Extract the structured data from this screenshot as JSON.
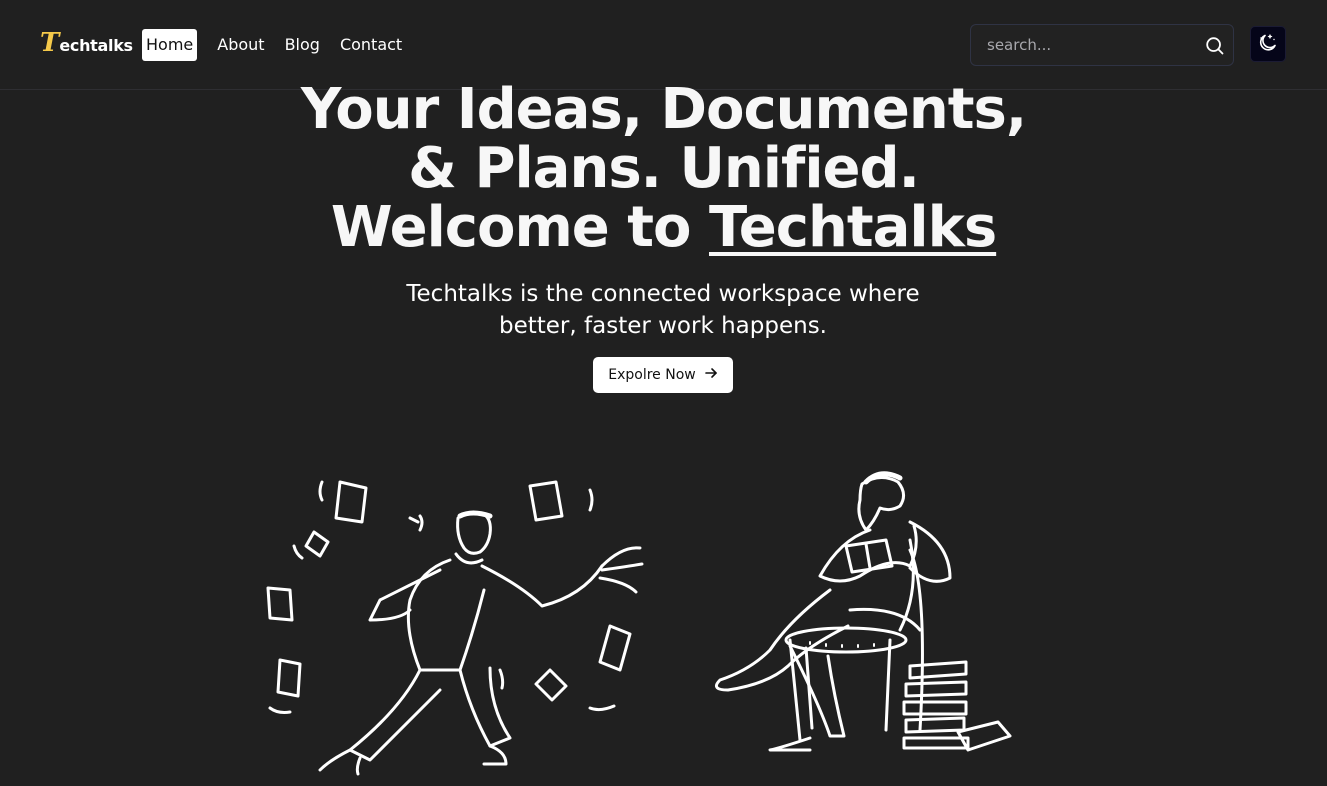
{
  "brand": {
    "logo_initial": "T",
    "logo_rest": "echtalks",
    "accent_color": "#f5c94a"
  },
  "nav": {
    "items": [
      {
        "label": "Home",
        "active": true
      },
      {
        "label": "About",
        "active": false
      },
      {
        "label": "Blog",
        "active": false
      },
      {
        "label": "Contact",
        "active": false
      }
    ]
  },
  "search": {
    "placeholder": "search...",
    "icon": "search-icon"
  },
  "theme_toggle": {
    "icon": "moon-stars-icon"
  },
  "hero": {
    "title_line1": "Your Ideas, Documents,",
    "title_line2": "& Plans. Unified.",
    "title_line3_prefix": "Welcome to ",
    "title_line3_brand": "Techtalks",
    "subtitle_line1": "Techtalks is the connected workspace where",
    "subtitle_line2": "better, faster work happens.",
    "cta_label": "Expolre Now",
    "cta_icon": "arrow-right-icon"
  },
  "illustration": {
    "left_figure": "person-juggling-papers",
    "right_figure": "person-reading-in-chair"
  },
  "colors": {
    "background": "#202020",
    "text": "#ffffff",
    "toggle_bg": "#050519"
  }
}
